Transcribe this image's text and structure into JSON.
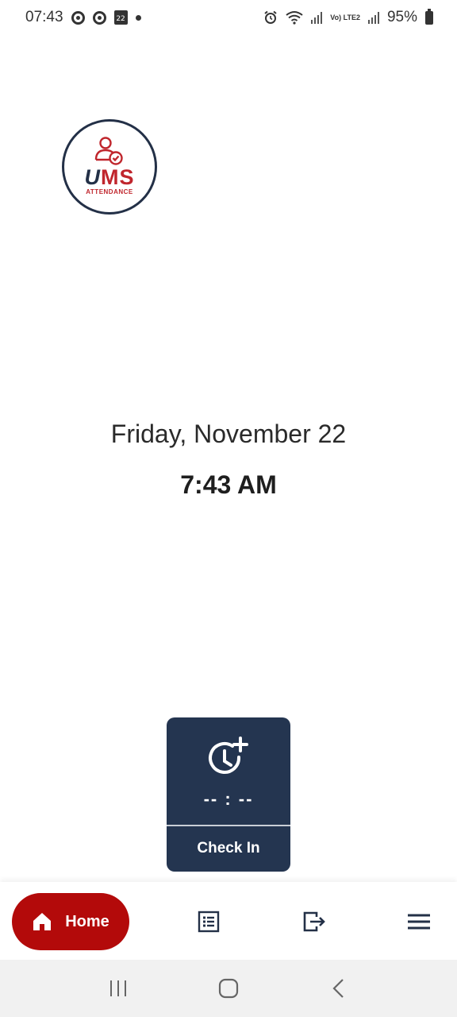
{
  "status_bar": {
    "time": "07:43",
    "calendar_day": "22",
    "network": "Vo) LTE2",
    "battery": "95%"
  },
  "logo": {
    "word_u": "U",
    "word_ms": "MS",
    "subtitle": "ATTENDANCE"
  },
  "main": {
    "date": "Friday, November 22",
    "time": "7:43 AM"
  },
  "checkin": {
    "time_placeholder": "-- : --",
    "label": "Check In"
  },
  "bottom_nav": {
    "home_label": "Home",
    "items": [
      "home-icon",
      "list-icon",
      "logout-icon",
      "menu-icon"
    ]
  },
  "colors": {
    "brand_red": "#b30a0a",
    "navy": "#243550",
    "logo_red": "#c0262d"
  }
}
